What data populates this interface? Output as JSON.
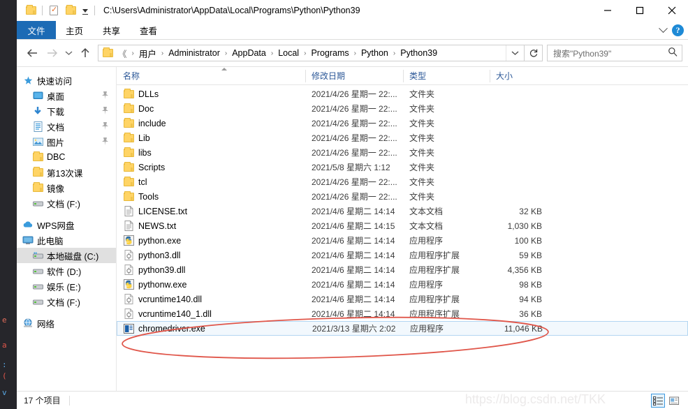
{
  "window": {
    "title_path": "C:\\Users\\Administrator\\AppData\\Local\\Programs\\Python\\Python39",
    "minimize_label": "最小化",
    "maximize_label": "最大化",
    "close_label": "关闭"
  },
  "quick_access_toolbar": {
    "folder_label": "资源管理器",
    "properties_label": "属性",
    "new_folder_label": "新建文件夹",
    "customize_label": "自定义快速访问工具栏"
  },
  "ribbon": {
    "tabs": [
      {
        "label": "文件",
        "active": true
      },
      {
        "label": "主页",
        "active": false
      },
      {
        "label": "共享",
        "active": false
      },
      {
        "label": "查看",
        "active": false
      }
    ],
    "expand_label": "展开功能区",
    "help_label": "?"
  },
  "navigation": {
    "back_label": "后退",
    "forward_label": "前进",
    "recent_label": "最近浏览的位置",
    "up_label": "上一级",
    "refresh_label": "刷新",
    "breadcrumbs": [
      "《",
      "用户",
      "Administrator",
      "AppData",
      "Local",
      "Programs",
      "Python",
      "Python39"
    ]
  },
  "search": {
    "placeholder": "搜索\"Python39\"",
    "value": ""
  },
  "sidebar": {
    "items": [
      {
        "label": "快速访问",
        "icon": "star-icon",
        "level": 0,
        "pinned": false,
        "selected": false
      },
      {
        "label": "桌面",
        "icon": "desktop-icon",
        "level": 1,
        "pinned": true,
        "selected": false
      },
      {
        "label": "下载",
        "icon": "download-icon",
        "level": 1,
        "pinned": true,
        "selected": false
      },
      {
        "label": "文档",
        "icon": "documents-icon",
        "level": 1,
        "pinned": true,
        "selected": false
      },
      {
        "label": "图片",
        "icon": "pictures-icon",
        "level": 1,
        "pinned": true,
        "selected": false
      },
      {
        "label": "DBC",
        "icon": "folder-icon",
        "level": 1,
        "pinned": false,
        "selected": false
      },
      {
        "label": "第13次课",
        "icon": "folder-icon",
        "level": 1,
        "pinned": false,
        "selected": false
      },
      {
        "label": "镜像",
        "icon": "folder-icon",
        "level": 1,
        "pinned": false,
        "selected": false
      },
      {
        "label": "文档 (F:)",
        "icon": "drive-icon",
        "level": 1,
        "pinned": false,
        "selected": false
      },
      {
        "label": "WPS网盘",
        "icon": "cloud-icon",
        "level": 0,
        "pinned": false,
        "selected": false
      },
      {
        "label": "此电脑",
        "icon": "computer-icon",
        "level": 0,
        "pinned": false,
        "selected": false
      },
      {
        "label": "本地磁盘 (C:)",
        "icon": "system-drive-icon",
        "level": 1,
        "pinned": false,
        "selected": true
      },
      {
        "label": "软件 (D:)",
        "icon": "drive-icon",
        "level": 1,
        "pinned": false,
        "selected": false
      },
      {
        "label": "娱乐 (E:)",
        "icon": "drive-icon",
        "level": 1,
        "pinned": false,
        "selected": false
      },
      {
        "label": "文档 (F:)",
        "icon": "drive-icon",
        "level": 1,
        "pinned": false,
        "selected": false
      },
      {
        "label": "网络",
        "icon": "network-icon",
        "level": 0,
        "pinned": false,
        "selected": false
      }
    ]
  },
  "file_list": {
    "columns": [
      {
        "label": "名称",
        "sorted": "asc"
      },
      {
        "label": "修改日期",
        "sorted": ""
      },
      {
        "label": "类型",
        "sorted": ""
      },
      {
        "label": "大小",
        "sorted": ""
      }
    ],
    "rows": [
      {
        "name": "DLLs",
        "date": "2021/4/26 星期一 22:...",
        "type": "文件夹",
        "size": "",
        "icon": "folder-icon",
        "selected": false
      },
      {
        "name": "Doc",
        "date": "2021/4/26 星期一 22:...",
        "type": "文件夹",
        "size": "",
        "icon": "folder-icon",
        "selected": false
      },
      {
        "name": "include",
        "date": "2021/4/26 星期一 22:...",
        "type": "文件夹",
        "size": "",
        "icon": "folder-icon",
        "selected": false
      },
      {
        "name": "Lib",
        "date": "2021/4/26 星期一 22:...",
        "type": "文件夹",
        "size": "",
        "icon": "folder-icon",
        "selected": false
      },
      {
        "name": "libs",
        "date": "2021/4/26 星期一 22:...",
        "type": "文件夹",
        "size": "",
        "icon": "folder-icon",
        "selected": false
      },
      {
        "name": "Scripts",
        "date": "2021/5/8 星期六 1:12",
        "type": "文件夹",
        "size": "",
        "icon": "folder-icon",
        "selected": false
      },
      {
        "name": "tcl",
        "date": "2021/4/26 星期一 22:...",
        "type": "文件夹",
        "size": "",
        "icon": "folder-icon",
        "selected": false
      },
      {
        "name": "Tools",
        "date": "2021/4/26 星期一 22:...",
        "type": "文件夹",
        "size": "",
        "icon": "folder-icon",
        "selected": false
      },
      {
        "name": "LICENSE.txt",
        "date": "2021/4/6 星期二 14:14",
        "type": "文本文档",
        "size": "32 KB",
        "icon": "text-file-icon",
        "selected": false
      },
      {
        "name": "NEWS.txt",
        "date": "2021/4/6 星期二 14:15",
        "type": "文本文档",
        "size": "1,030 KB",
        "icon": "text-file-icon",
        "selected": false
      },
      {
        "name": "python.exe",
        "date": "2021/4/6 星期二 14:14",
        "type": "应用程序",
        "size": "100 KB",
        "icon": "python-exe-icon",
        "selected": false
      },
      {
        "name": "python3.dll",
        "date": "2021/4/6 星期二 14:14",
        "type": "应用程序扩展",
        "size": "59 KB",
        "icon": "dll-icon",
        "selected": false
      },
      {
        "name": "python39.dll",
        "date": "2021/4/6 星期二 14:14",
        "type": "应用程序扩展",
        "size": "4,356 KB",
        "icon": "dll-icon",
        "selected": false
      },
      {
        "name": "pythonw.exe",
        "date": "2021/4/6 星期二 14:14",
        "type": "应用程序",
        "size": "98 KB",
        "icon": "python-exe-icon",
        "selected": false
      },
      {
        "name": "vcruntime140.dll",
        "date": "2021/4/6 星期二 14:14",
        "type": "应用程序扩展",
        "size": "94 KB",
        "icon": "dll-icon",
        "selected": false
      },
      {
        "name": "vcruntime140_1.dll",
        "date": "2021/4/6 星期二 14:14",
        "type": "应用程序扩展",
        "size": "36 KB",
        "icon": "dll-icon",
        "selected": false
      },
      {
        "name": "chromedriver.exe",
        "date": "2021/3/13 星期六 2:02",
        "type": "应用程序",
        "size": "11,046 KB",
        "icon": "chromedriver-icon",
        "selected": true
      }
    ]
  },
  "statusbar": {
    "item_count": "17 个项目",
    "details_view_label": "详细信息",
    "large_icons_view_label": "大图标"
  },
  "watermark": {
    "text": "https://blog.csdn.net/TKK"
  },
  "annotation": {
    "color": "#e0564a",
    "shape": "ellipse"
  },
  "background_code": {
    "fragments": [
      "e",
      "a",
      ":",
      "(",
      "v"
    ]
  },
  "colors": {
    "accent": "#1c6bb5",
    "column_header": "#2b5797",
    "selection": "#e0e0e0",
    "row_selection_bg": "#f2f8fd",
    "row_selection_border": "#b3d6f2",
    "annotation_red": "#e0564a"
  }
}
